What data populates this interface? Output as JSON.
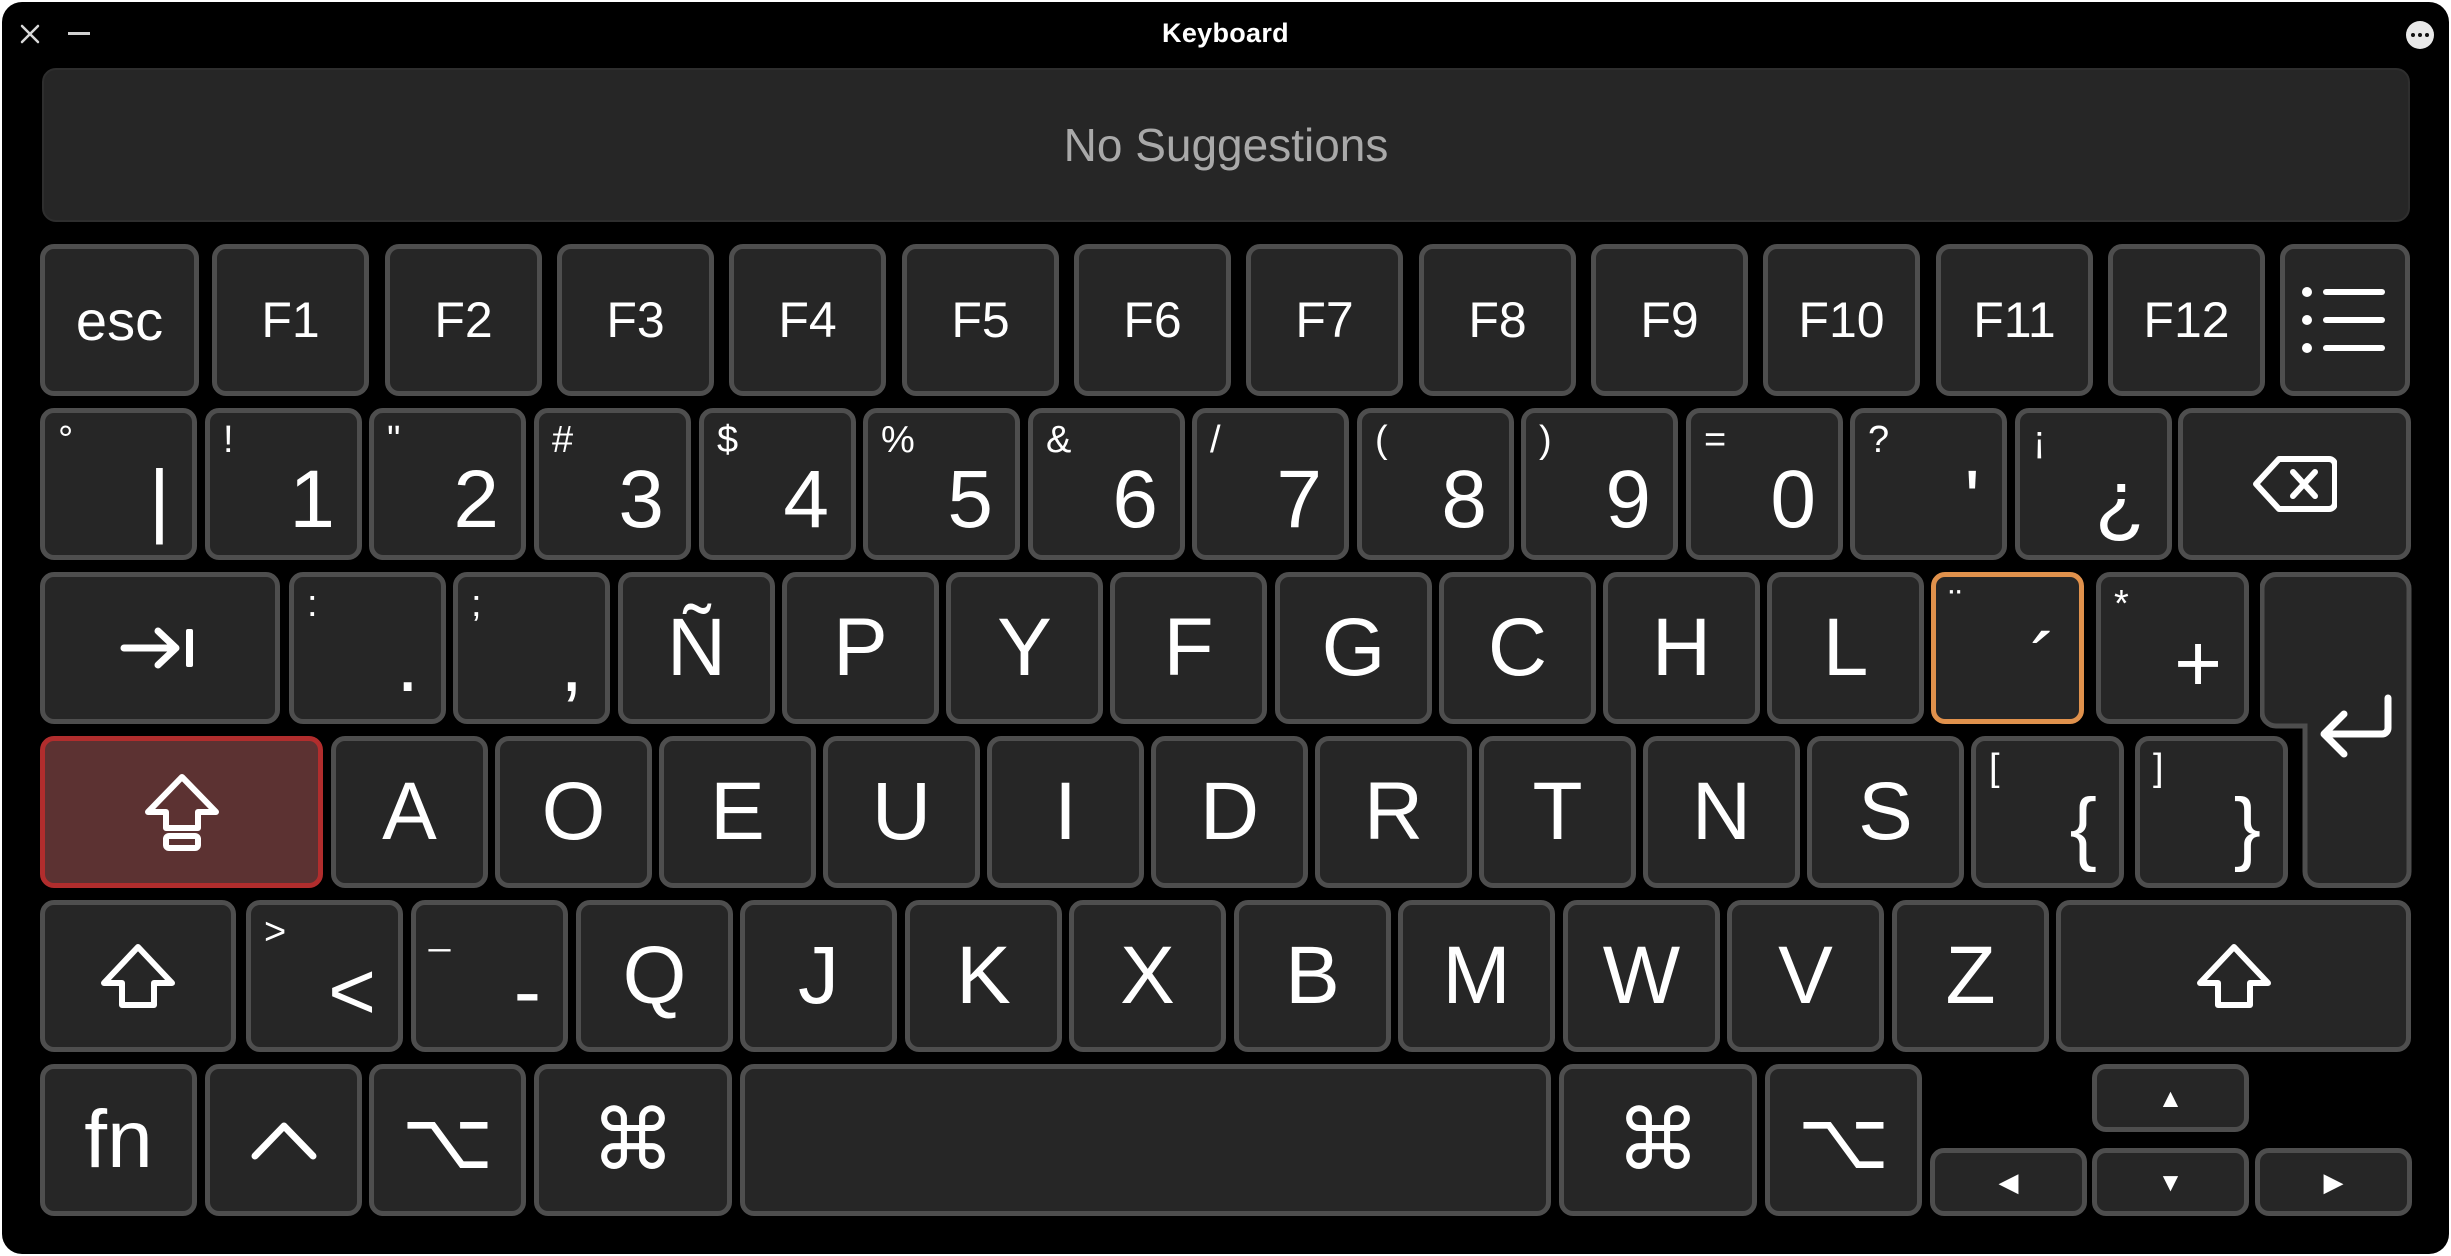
{
  "window": {
    "title": "Keyboard"
  },
  "suggestions": {
    "text": "No Suggestions"
  },
  "rows": {
    "function": [
      "esc",
      "F1",
      "F2",
      "F3",
      "F4",
      "F5",
      "F6",
      "F7",
      "F8",
      "F9",
      "F10",
      "F11",
      "F12"
    ],
    "number": [
      {
        "sup": "°",
        "main": "|"
      },
      {
        "sup": "!",
        "main": "1"
      },
      {
        "sup": "\"",
        "main": "2"
      },
      {
        "sup": "#",
        "main": "3"
      },
      {
        "sup": "$",
        "main": "4"
      },
      {
        "sup": "%",
        "main": "5"
      },
      {
        "sup": "&",
        "main": "6"
      },
      {
        "sup": "/",
        "main": "7"
      },
      {
        "sup": "(",
        "main": "8"
      },
      {
        "sup": ")",
        "main": "9"
      },
      {
        "sup": "=",
        "main": "0"
      },
      {
        "sup": "?",
        "main": "'"
      },
      {
        "sup": "¡",
        "main": "¿"
      }
    ],
    "top": [
      {
        "sup": ":",
        "main": "."
      },
      {
        "sup": ";",
        "main": ","
      },
      {
        "main": "Ñ"
      },
      {
        "main": "P"
      },
      {
        "main": "Y"
      },
      {
        "main": "F"
      },
      {
        "main": "G"
      },
      {
        "main": "C"
      },
      {
        "main": "H"
      },
      {
        "main": "L"
      },
      {
        "sup": "¨",
        "main": "´"
      },
      {
        "sup": "*",
        "main": "+"
      }
    ],
    "home": [
      {
        "main": "A"
      },
      {
        "main": "O"
      },
      {
        "main": "E"
      },
      {
        "main": "U"
      },
      {
        "main": "I"
      },
      {
        "main": "D"
      },
      {
        "main": "R"
      },
      {
        "main": "T"
      },
      {
        "main": "N"
      },
      {
        "main": "S"
      },
      {
        "sup": "[",
        "main": "{"
      },
      {
        "sup": "]",
        "main": "}"
      }
    ],
    "bottom": [
      {
        "sup": ">",
        "main": "<"
      },
      {
        "sup": "_",
        "main": "-"
      },
      {
        "main": "Q"
      },
      {
        "main": "J"
      },
      {
        "main": "K"
      },
      {
        "main": "X"
      },
      {
        "main": "B"
      },
      {
        "main": "M"
      },
      {
        "main": "W"
      },
      {
        "main": "V"
      },
      {
        "main": "Z"
      }
    ],
    "modifiers": {
      "fn": "fn",
      "control": "^",
      "option": "⌥",
      "command": "⌘"
    },
    "arrows": {
      "up": "▲",
      "left": "◀",
      "down": "▼",
      "right": "▶"
    }
  },
  "state": {
    "selected_key": "´",
    "caps_lock": "on"
  },
  "colors": {
    "key_bg": "#262626",
    "key_border": "#4e4e4e",
    "selected_border": "#e0914c",
    "caps_active_bg": "#5c3232",
    "caps_active_border": "#b12d2d"
  },
  "icons": [
    "close-icon",
    "minimize-icon",
    "more-icon",
    "menu-icon",
    "delete-icon",
    "tab-icon",
    "return-icon",
    "caps-lock-icon",
    "shift-icon"
  ]
}
